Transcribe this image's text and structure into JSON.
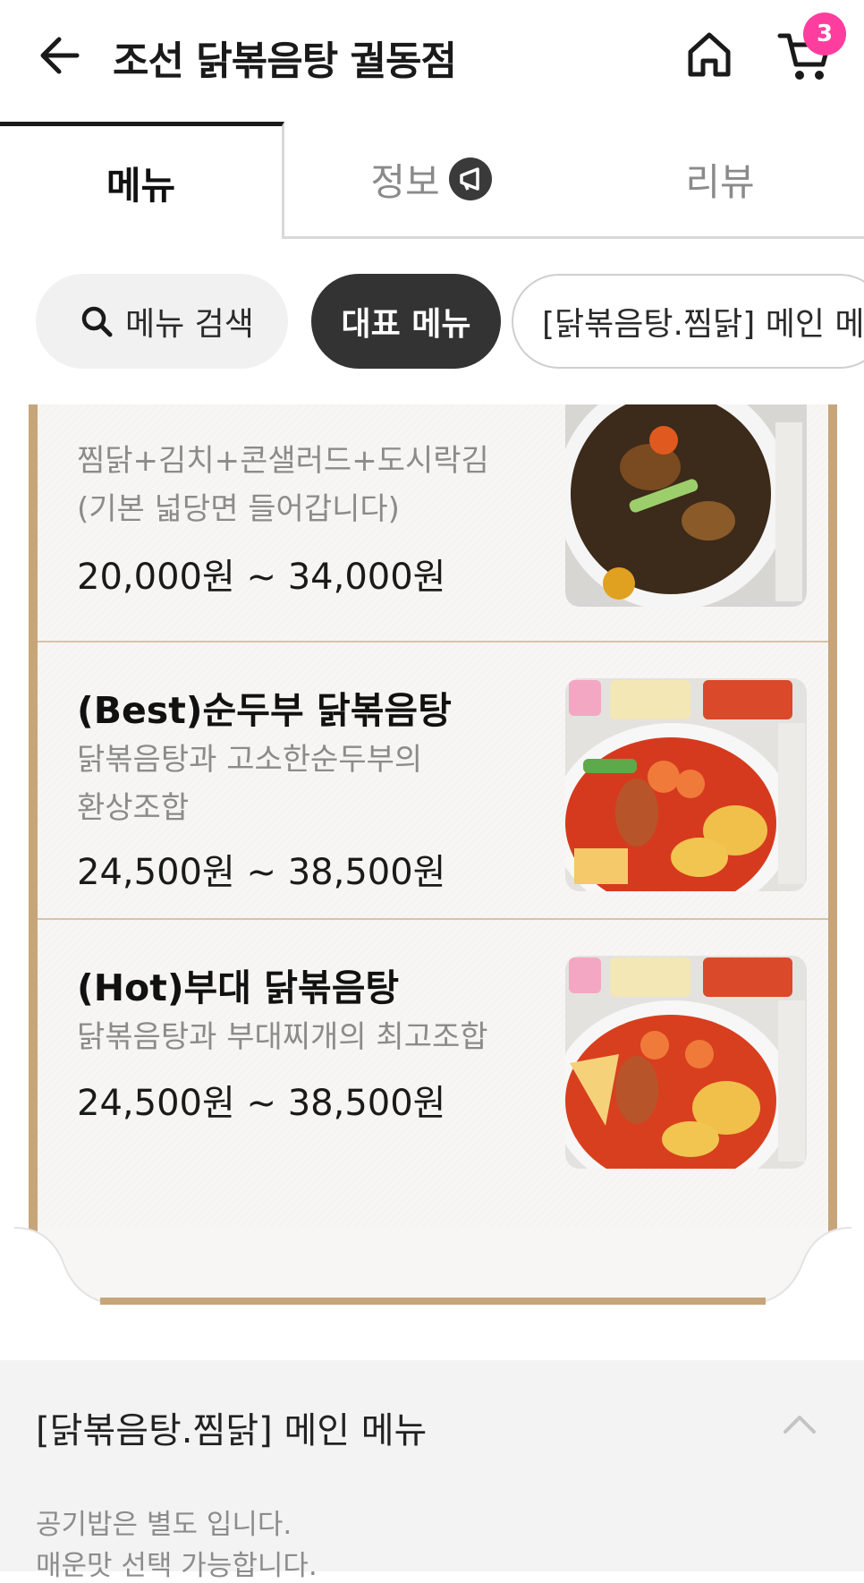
{
  "header": {
    "title": "조선 닭볶음탕 궐동점",
    "cart_count": "3"
  },
  "tabs": [
    {
      "label": "메뉴",
      "active": true
    },
    {
      "label": "정보",
      "active": false
    },
    {
      "label": "리뷰",
      "active": false
    }
  ],
  "chips": {
    "search_label": "메뉴 검색",
    "representative_label": "대표 메뉴",
    "main_label": "[닭볶음탕.찜닭] 메인 메..."
  },
  "menu_items": [
    {
      "name": "(Best)순두부 닭볶음탕",
      "desc_line1": "닭볶음탕과 고소한순두부의",
      "desc_line2": "환상조합",
      "price": "24,500원 ~ 38,500원"
    },
    {
      "name": "(Hot)부대 닭볶음탕",
      "desc_line1": "닭볶음탕과 부대찌개의 최고조합",
      "price": "24,500원 ~ 38,500원"
    }
  ],
  "partial_item": {
    "desc_line1": "찜닭+김치+콘샐러드+도시락김",
    "desc_line2": "(기본 넓당면 들어갑니다)",
    "price": "20,000원 ~ 34,000원"
  },
  "section": {
    "title": "[닭볶음탕.찜닭] 메인 메뉴",
    "note_line1": "공기밥은 별도 입니다.",
    "note_line2": "매운맛 선택 가능합니다."
  },
  "colors": {
    "accent_badge": "#ff3d9e",
    "frame": "#c7a57a",
    "chip_active": "#333333"
  }
}
